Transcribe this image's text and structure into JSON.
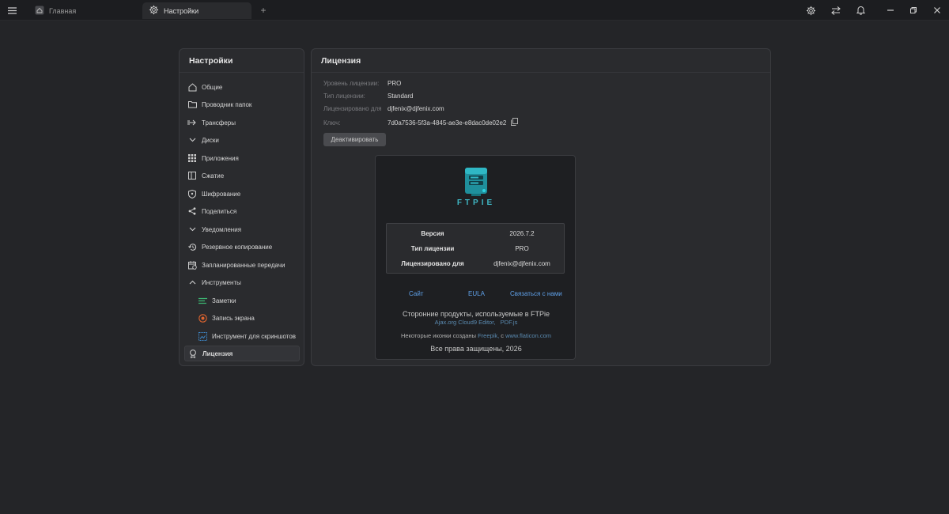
{
  "topbar": {
    "tabs": [
      {
        "label": "Главная",
        "icon": "home-icon"
      },
      {
        "label": "Настройки",
        "icon": "gear-icon"
      }
    ],
    "add_tab_label": "+",
    "right_icons": [
      "gear-icon",
      "transfer-icon",
      "bell-icon",
      "minimize-icon",
      "restore-icon",
      "close-icon"
    ]
  },
  "sidebar": {
    "title": "Настройки",
    "items": [
      {
        "label": "Общие",
        "icon": "home-icon"
      },
      {
        "label": "Проводник папок",
        "icon": "folder-icon"
      },
      {
        "label": "Трансферы",
        "icon": "transfer-arrow-icon"
      },
      {
        "label": "Диски",
        "icon": "chevron-down-icon"
      },
      {
        "label": "Приложения",
        "icon": "grid-icon"
      },
      {
        "label": "Сжатие",
        "icon": "archive-icon"
      },
      {
        "label": "Шифрование",
        "icon": "shield-icon"
      },
      {
        "label": "Поделиться",
        "icon": "share-icon"
      },
      {
        "label": "Уведомления",
        "icon": "chevron-down-icon"
      },
      {
        "label": "Резервное копирование",
        "icon": "history-icon"
      },
      {
        "label": "Запланированные передачи",
        "icon": "calendar-icon"
      },
      {
        "label": "Инструменты",
        "icon": "chevron-up-icon"
      },
      {
        "label": "Заметки",
        "icon": "notes-icon"
      },
      {
        "label": "Запись экрана",
        "icon": "record-icon"
      },
      {
        "label": "Инструмент для скриншотов",
        "icon": "screenshot-icon"
      },
      {
        "label": "Лицензия",
        "icon": "license-icon"
      }
    ]
  },
  "license": {
    "title": "Лицензия",
    "rows": [
      {
        "label": "Уровень лицензии:",
        "value": "PRO"
      },
      {
        "label": "Тип лицензии:",
        "value": "Standard"
      },
      {
        "label": "Лицензировано для",
        "value": "djfenix@djfenix.com"
      },
      {
        "label": "Ключ:",
        "value": "7d0a7536-5f3a-4845-ae3e-e8dac0de02e2"
      }
    ],
    "deactivate_label": "Деактивировать"
  },
  "about": {
    "logo_text": "FTPIE",
    "table": [
      {
        "key": "Версия",
        "value": "2026.7.2"
      },
      {
        "key": "Тип лицензии",
        "value": "PRO"
      },
      {
        "key": "Лицензировано для",
        "value": "djfenix@djfenix.com"
      }
    ],
    "links": {
      "site": "Сайт",
      "eula": "EULA",
      "contact": "Связаться с нами"
    },
    "third_party_title": "Сторонние продукты, используемые в FTPie",
    "third_party_1": "Ajax.org Cloud9 Editor,",
    "third_party_2": "PDF.js",
    "icons_prefix": "Некоторые иконки созданы",
    "icons_author": "Freepik,",
    "icons_mid": "с",
    "icons_site": "www.flaticon.com",
    "rights": "Все права защищены, 2026"
  },
  "colors": {
    "background": "#242528",
    "panel": "#2a2b2e",
    "accent_teal": "#3fb6c3",
    "link_blue": "#5fa0e8"
  }
}
